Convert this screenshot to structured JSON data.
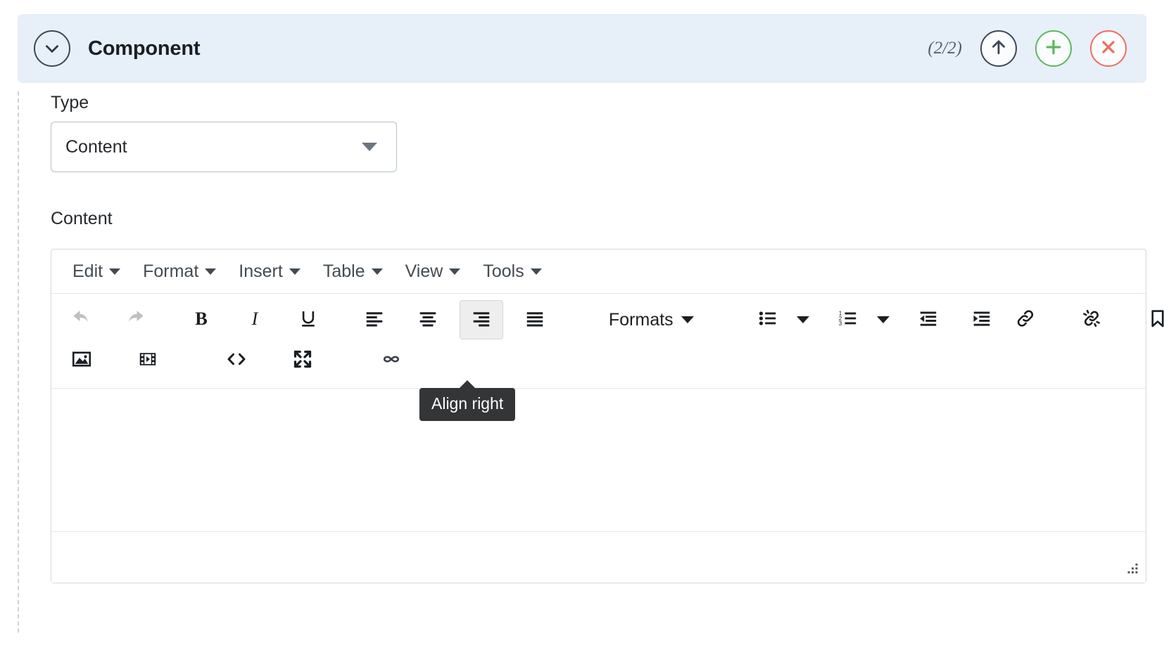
{
  "panel": {
    "title": "Component",
    "counter": "(2/2)",
    "collapse_icon": "chevron-down-icon",
    "move_up_icon": "arrow-up-icon",
    "add_icon": "plus-icon",
    "remove_icon": "close-x-icon",
    "colors": {
      "header_bg": "#e7eff8",
      "add": "#5cb85c",
      "remove": "#ef6c61",
      "outline": "#3c4858"
    }
  },
  "form": {
    "type": {
      "label": "Type",
      "value": "Content",
      "options": [
        "Content"
      ],
      "caret_icon": "chevron-down-icon"
    },
    "content": {
      "label": "Content",
      "value": ""
    }
  },
  "editor": {
    "menubar": [
      {
        "label": "Edit",
        "name": "menu-edit"
      },
      {
        "label": "Format",
        "name": "menu-format"
      },
      {
        "label": "Insert",
        "name": "menu-insert"
      },
      {
        "label": "Table",
        "name": "menu-table"
      },
      {
        "label": "View",
        "name": "menu-view"
      },
      {
        "label": "Tools",
        "name": "menu-tools"
      }
    ],
    "toolbar_row1": [
      {
        "name": "undo-button",
        "icon": "undo-icon",
        "state": "disabled"
      },
      {
        "name": "redo-button",
        "icon": "redo-icon",
        "state": "disabled"
      },
      {
        "name": "bold-button",
        "icon": "bold-icon",
        "state": "normal"
      },
      {
        "name": "italic-button",
        "icon": "italic-icon",
        "state": "normal"
      },
      {
        "name": "underline-button",
        "icon": "underline-icon",
        "state": "normal"
      },
      {
        "name": "align-left-button",
        "icon": "align-left-icon",
        "state": "normal"
      },
      {
        "name": "align-center-button",
        "icon": "align-center-icon",
        "state": "normal"
      },
      {
        "name": "align-right-button",
        "icon": "align-right-icon",
        "state": "active"
      },
      {
        "name": "align-justify-button",
        "icon": "align-justify-icon",
        "state": "normal"
      },
      {
        "name": "formats-dropdown",
        "label": "Formats",
        "icon": "chevron-down-icon",
        "state": "normal"
      },
      {
        "name": "bullet-list-button",
        "icon": "bullet-list-icon",
        "state": "normal"
      },
      {
        "name": "numbered-list-button",
        "icon": "numbered-list-icon",
        "state": "normal"
      },
      {
        "name": "outdent-button",
        "icon": "outdent-icon",
        "state": "normal"
      },
      {
        "name": "indent-button",
        "icon": "indent-icon",
        "state": "normal"
      },
      {
        "name": "insert-link-button",
        "icon": "link-icon",
        "state": "normal"
      },
      {
        "name": "remove-link-button",
        "icon": "unlink-icon",
        "state": "normal"
      },
      {
        "name": "anchor-button",
        "icon": "bookmark-icon",
        "state": "normal"
      }
    ],
    "toolbar_row2": [
      {
        "name": "insert-image-button",
        "icon": "image-icon",
        "state": "normal"
      },
      {
        "name": "insert-media-button",
        "icon": "media-film-icon",
        "state": "normal"
      },
      {
        "name": "source-code-button",
        "icon": "code-angle-brackets-icon",
        "state": "normal"
      },
      {
        "name": "fullscreen-button",
        "icon": "fullscreen-expand-icon",
        "state": "normal"
      },
      {
        "name": "special-character-button",
        "icon": "infinity-icon",
        "state": "normal"
      }
    ],
    "formats_label": "Formats",
    "tooltip": "Align right",
    "resize_handle_icon": "resize-grip-icon"
  }
}
